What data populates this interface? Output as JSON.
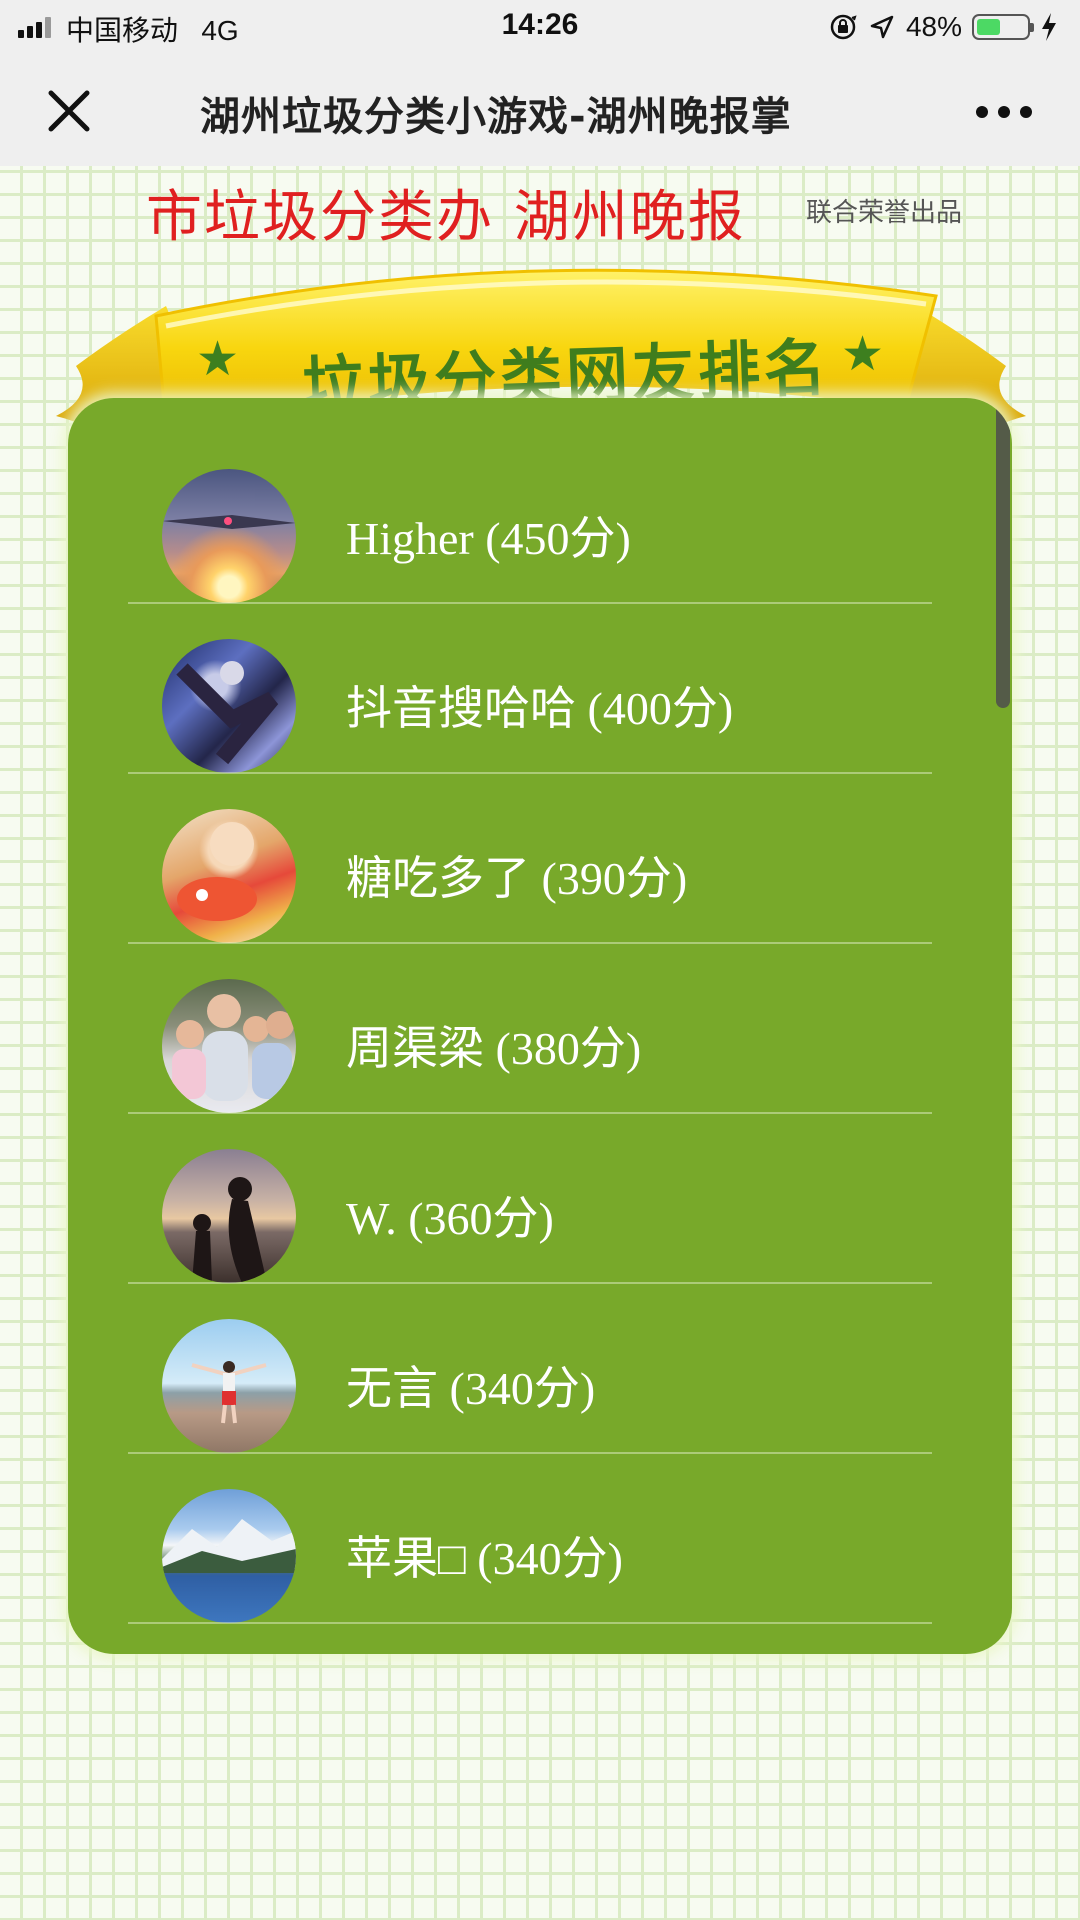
{
  "status_bar": {
    "carrier": "中国移动",
    "network": "4G",
    "time": "14:26",
    "battery": "48%",
    "battery_level": 0.48,
    "icons": [
      "signal-icon",
      "rotation-lock-icon",
      "location-icon",
      "battery-icon",
      "charging-icon"
    ]
  },
  "nav": {
    "close_icon": "close-icon",
    "title": "湖州垃圾分类小游戏-湖州晚报掌",
    "more_icon": "more-icon"
  },
  "header": {
    "sponsors": "市垃圾分类办 湖州晚报",
    "sponsor_note": "联合荣誉出品"
  },
  "banner": {
    "title": "垃圾分类网友排名",
    "star": "★"
  },
  "ranking": {
    "items": [
      {
        "name": "Higher (450分)"
      },
      {
        "name": "抖音搜哈哈 (400分)"
      },
      {
        "name": "糖吃多了 (390分)"
      },
      {
        "name": "周渠梁 (380分)"
      },
      {
        "name": "W. (360分)"
      },
      {
        "name": "无言 (340分)"
      },
      {
        "name": "苹果□ (340分)"
      }
    ]
  },
  "colors": {
    "panel": "#78a92a",
    "ribbon": "#f6d20f",
    "sponsor_red": "#e02020",
    "ribbon_text": "#3f7d1d"
  }
}
